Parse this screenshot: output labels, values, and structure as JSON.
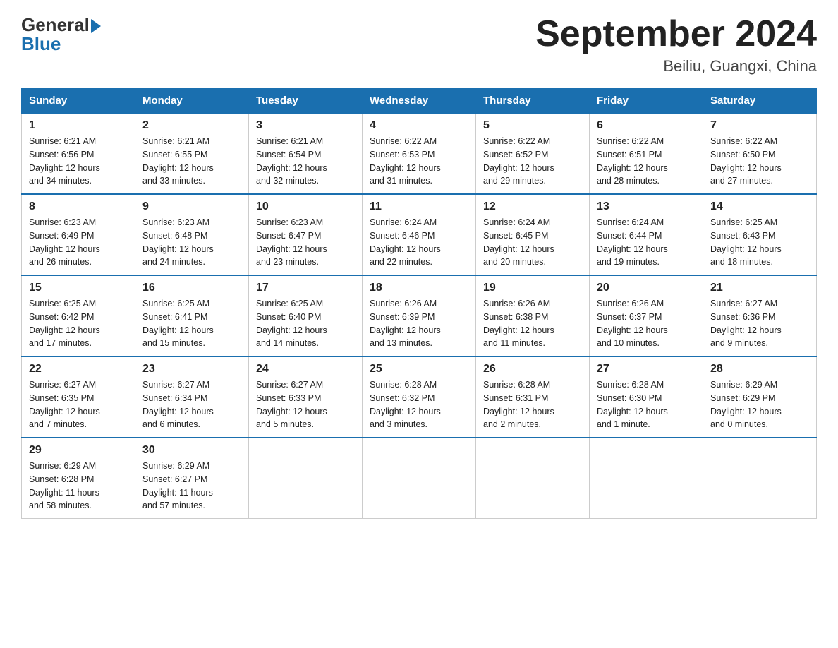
{
  "header": {
    "logo_general": "General",
    "logo_blue": "Blue",
    "month_year": "September 2024",
    "location": "Beiliu, Guangxi, China"
  },
  "weekdays": [
    "Sunday",
    "Monday",
    "Tuesday",
    "Wednesday",
    "Thursday",
    "Friday",
    "Saturday"
  ],
  "weeks": [
    [
      {
        "day": "1",
        "sunrise": "6:21 AM",
        "sunset": "6:56 PM",
        "daylight": "12 hours and 34 minutes."
      },
      {
        "day": "2",
        "sunrise": "6:21 AM",
        "sunset": "6:55 PM",
        "daylight": "12 hours and 33 minutes."
      },
      {
        "day": "3",
        "sunrise": "6:21 AM",
        "sunset": "6:54 PM",
        "daylight": "12 hours and 32 minutes."
      },
      {
        "day": "4",
        "sunrise": "6:22 AM",
        "sunset": "6:53 PM",
        "daylight": "12 hours and 31 minutes."
      },
      {
        "day": "5",
        "sunrise": "6:22 AM",
        "sunset": "6:52 PM",
        "daylight": "12 hours and 29 minutes."
      },
      {
        "day": "6",
        "sunrise": "6:22 AM",
        "sunset": "6:51 PM",
        "daylight": "12 hours and 28 minutes."
      },
      {
        "day": "7",
        "sunrise": "6:22 AM",
        "sunset": "6:50 PM",
        "daylight": "12 hours and 27 minutes."
      }
    ],
    [
      {
        "day": "8",
        "sunrise": "6:23 AM",
        "sunset": "6:49 PM",
        "daylight": "12 hours and 26 minutes."
      },
      {
        "day": "9",
        "sunrise": "6:23 AM",
        "sunset": "6:48 PM",
        "daylight": "12 hours and 24 minutes."
      },
      {
        "day": "10",
        "sunrise": "6:23 AM",
        "sunset": "6:47 PM",
        "daylight": "12 hours and 23 minutes."
      },
      {
        "day": "11",
        "sunrise": "6:24 AM",
        "sunset": "6:46 PM",
        "daylight": "12 hours and 22 minutes."
      },
      {
        "day": "12",
        "sunrise": "6:24 AM",
        "sunset": "6:45 PM",
        "daylight": "12 hours and 20 minutes."
      },
      {
        "day": "13",
        "sunrise": "6:24 AM",
        "sunset": "6:44 PM",
        "daylight": "12 hours and 19 minutes."
      },
      {
        "day": "14",
        "sunrise": "6:25 AM",
        "sunset": "6:43 PM",
        "daylight": "12 hours and 18 minutes."
      }
    ],
    [
      {
        "day": "15",
        "sunrise": "6:25 AM",
        "sunset": "6:42 PM",
        "daylight": "12 hours and 17 minutes."
      },
      {
        "day": "16",
        "sunrise": "6:25 AM",
        "sunset": "6:41 PM",
        "daylight": "12 hours and 15 minutes."
      },
      {
        "day": "17",
        "sunrise": "6:25 AM",
        "sunset": "6:40 PM",
        "daylight": "12 hours and 14 minutes."
      },
      {
        "day": "18",
        "sunrise": "6:26 AM",
        "sunset": "6:39 PM",
        "daylight": "12 hours and 13 minutes."
      },
      {
        "day": "19",
        "sunrise": "6:26 AM",
        "sunset": "6:38 PM",
        "daylight": "12 hours and 11 minutes."
      },
      {
        "day": "20",
        "sunrise": "6:26 AM",
        "sunset": "6:37 PM",
        "daylight": "12 hours and 10 minutes."
      },
      {
        "day": "21",
        "sunrise": "6:27 AM",
        "sunset": "6:36 PM",
        "daylight": "12 hours and 9 minutes."
      }
    ],
    [
      {
        "day": "22",
        "sunrise": "6:27 AM",
        "sunset": "6:35 PM",
        "daylight": "12 hours and 7 minutes."
      },
      {
        "day": "23",
        "sunrise": "6:27 AM",
        "sunset": "6:34 PM",
        "daylight": "12 hours and 6 minutes."
      },
      {
        "day": "24",
        "sunrise": "6:27 AM",
        "sunset": "6:33 PM",
        "daylight": "12 hours and 5 minutes."
      },
      {
        "day": "25",
        "sunrise": "6:28 AM",
        "sunset": "6:32 PM",
        "daylight": "12 hours and 3 minutes."
      },
      {
        "day": "26",
        "sunrise": "6:28 AM",
        "sunset": "6:31 PM",
        "daylight": "12 hours and 2 minutes."
      },
      {
        "day": "27",
        "sunrise": "6:28 AM",
        "sunset": "6:30 PM",
        "daylight": "12 hours and 1 minute."
      },
      {
        "day": "28",
        "sunrise": "6:29 AM",
        "sunset": "6:29 PM",
        "daylight": "12 hours and 0 minutes."
      }
    ],
    [
      {
        "day": "29",
        "sunrise": "6:29 AM",
        "sunset": "6:28 PM",
        "daylight": "11 hours and 58 minutes."
      },
      {
        "day": "30",
        "sunrise": "6:29 AM",
        "sunset": "6:27 PM",
        "daylight": "11 hours and 57 minutes."
      },
      null,
      null,
      null,
      null,
      null
    ]
  ],
  "labels": {
    "sunrise": "Sunrise:",
    "sunset": "Sunset:",
    "daylight": "Daylight:"
  }
}
